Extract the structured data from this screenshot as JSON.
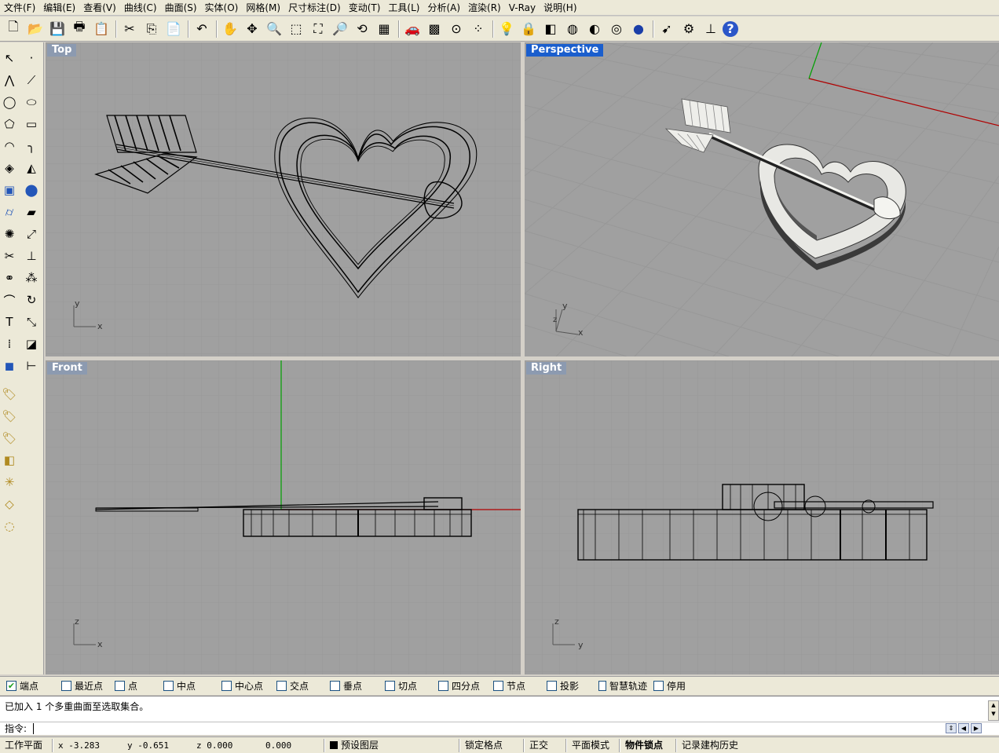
{
  "menubar": {
    "items": [
      "文件(F)",
      "编辑(E)",
      "查看(V)",
      "曲线(C)",
      "曲面(S)",
      "实体(O)",
      "网格(M)",
      "尺寸标注(D)",
      "变动(T)",
      "工具(L)",
      "分析(A)",
      "渲染(R)",
      "V-Ray",
      "说明(H)"
    ]
  },
  "toolbar": {
    "icons": [
      "new-file-icon",
      "open-folder-icon",
      "save-icon",
      "print-icon",
      "properties-icon",
      "cut-icon",
      "copy-icon",
      "paste-icon",
      "undo-icon",
      "pan-hand-icon",
      "rotate-view-icon",
      "zoom-dynamic-icon",
      "zoom-window-icon",
      "zoom-extents-icon",
      "zoom-selected-icon",
      "undo-view-icon",
      "four-viewports-icon",
      "car-icon",
      "grid-plane-icon",
      "osnap-icon",
      "select-points-icon",
      "light-bulb-icon",
      "lock-icon",
      "layer-icon",
      "color-wheel-icon",
      "shade-icon",
      "render-preview-icon",
      "render-sphere-icon",
      "cursor-tool-icon",
      "options-gear-icon",
      "dimension-icon",
      "help-icon"
    ]
  },
  "viewports": {
    "top": {
      "label": "Top",
      "axis1": "x",
      "axis2": "y"
    },
    "perspective": {
      "label": "Perspective",
      "axis1": "x",
      "axis2": "y",
      "axis3": "z"
    },
    "front": {
      "label": "Front",
      "axis1": "x",
      "axis2": "z"
    },
    "right": {
      "label": "Right",
      "axis1": "y",
      "axis2": "z"
    }
  },
  "osnap": {
    "items": [
      {
        "label": "端点",
        "checked": true
      },
      {
        "label": "最近点",
        "checked": false
      },
      {
        "label": "点",
        "checked": false
      },
      {
        "label": "中点",
        "checked": false
      },
      {
        "label": "中心点",
        "checked": false
      },
      {
        "label": "交点",
        "checked": false
      },
      {
        "label": "垂点",
        "checked": false
      },
      {
        "label": "切点",
        "checked": false
      },
      {
        "label": "四分点",
        "checked": false
      },
      {
        "label": "节点",
        "checked": false
      },
      {
        "label": "投影",
        "checked": false
      },
      {
        "label": "智慧轨迹",
        "checked": false
      },
      {
        "label": "停用",
        "checked": false
      }
    ]
  },
  "command": {
    "history": "已加入 1 个多重曲面至选取集合。",
    "prompt": "指令:"
  },
  "status": {
    "plane": "工作平面",
    "x": "x -3.283",
    "y": "y -0.651",
    "z": "z 0.000",
    "d": "0.000",
    "layer": "预设图层",
    "grid_snap": "锁定格点",
    "ortho": "正交",
    "planar": "平面模式",
    "osnap": "物件锁点",
    "history": "记录建构历史"
  },
  "colors": {
    "viewport_bg": "#a0a0a0",
    "active_title": "#1a5ecd",
    "x_axis": "#b00000",
    "y_axis": "#00a000"
  }
}
